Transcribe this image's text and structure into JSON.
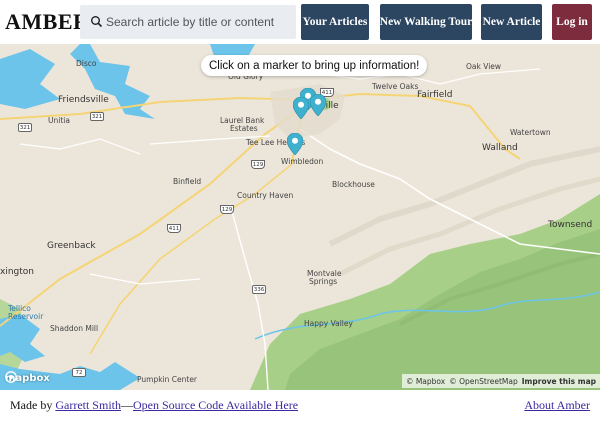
{
  "header": {
    "logo": "AMBER",
    "search_placeholder": "Search article by title or content",
    "buttons": {
      "your_articles": "Your Articles",
      "new_walking_tour": "New Walking Tour",
      "new_article": "New Article",
      "log_in": "Log in"
    }
  },
  "map": {
    "tooltip": "Click on a marker to bring up information!",
    "places": {
      "disco": "Disco",
      "old_glory": "Old Glory",
      "oak_view": "Oak View",
      "twelve_oaks": "Twelve Oaks",
      "fairfield": "Fairfield",
      "friendsville": "Friendsville",
      "unitia": "Unitia",
      "laurel_bank": "Laurel Bank",
      "estates": "Estates",
      "tee_lee_heights": "Tee Lee Heights",
      "maryville": "Maryville",
      "wimbledon": "Wimbledon",
      "watertown": "Watertown",
      "walland": "Walland",
      "binfield": "Binfield",
      "country_haven": "Country Haven",
      "blockhouse": "Blockhouse",
      "greenback": "Greenback",
      "townsend": "Townsend",
      "montvale": "Montvale",
      "springs": "Springs",
      "happy_valley": "Happy Valley",
      "shaddon_mill": "Shaddon Mill",
      "tellico": "Tellico",
      "reservoir": "Reservoir",
      "pumpkin_center": "Pumpkin Center",
      "lexington_partial": "xington"
    },
    "shields": {
      "r321a": "321",
      "r321b": "321",
      "r411a": "411",
      "r411b": "411",
      "r129a": "129",
      "r129b": "129",
      "r336": "336",
      "r72": "72"
    },
    "logo": "mapbox",
    "attribution": {
      "mapbox": "© Mapbox",
      "osm": "© OpenStreetMap",
      "improve": "Improve this map"
    },
    "colors": {
      "marker": "#3fb1ce",
      "water": "#6cc4ea",
      "forest": "#a9cf8a",
      "road": "#f5d476"
    }
  },
  "footer": {
    "made_by": "Made by ",
    "author": "Garrett Smith",
    "dash": "—",
    "source_link": "Open Source Code Available Here",
    "about": "About Amber"
  }
}
